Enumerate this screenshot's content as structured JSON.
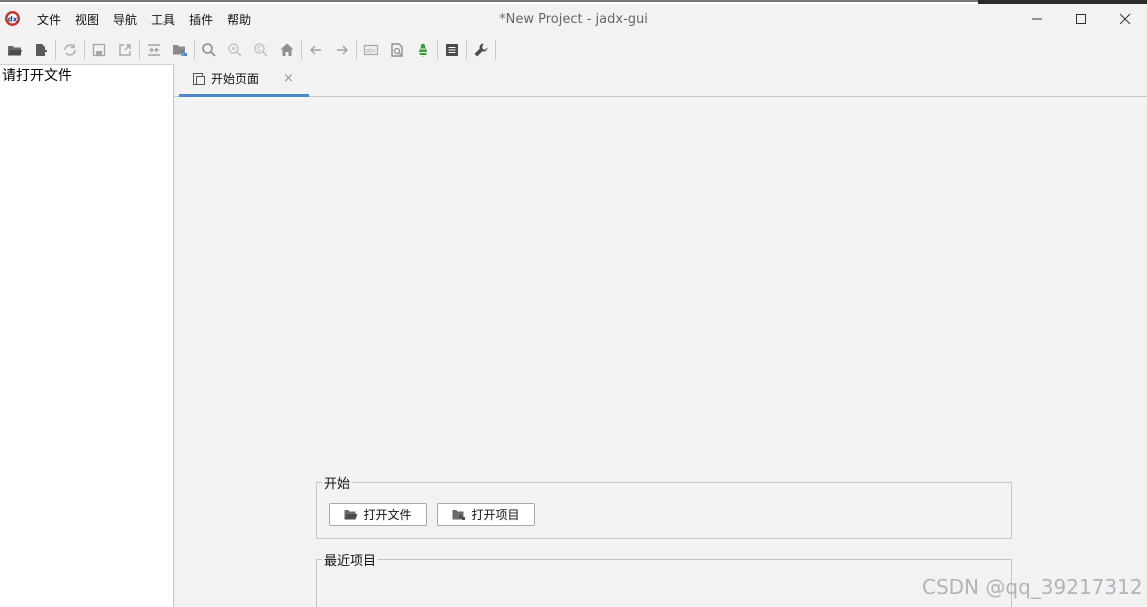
{
  "window": {
    "title": "*New Project - jadx-gui"
  },
  "menu": [
    {
      "label": "文件"
    },
    {
      "label": "视图"
    },
    {
      "label": "导航"
    },
    {
      "label": "工具"
    },
    {
      "label": "插件"
    },
    {
      "label": "帮助"
    }
  ],
  "toolbar": {
    "icons": [
      "open-folder-icon",
      "add-files-icon",
      "sync-icon",
      "save-icon",
      "export-icon",
      "flatten-packages-icon",
      "package-view-icon",
      "search-icon",
      "find-usage-icon",
      "find-class-icon",
      "home-icon",
      "back-arrow-icon",
      "forward-arrow-icon",
      "deobfuscation-icon",
      "quark-icon",
      "debug-bug-icon",
      "log-viewer-icon",
      "preferences-wrench-icon"
    ]
  },
  "tree": {
    "placeholder": "请打开文件"
  },
  "tabs": [
    {
      "label": "开始页面",
      "close": "×",
      "active": true
    }
  ],
  "start_page": {
    "start_group": {
      "title": "开始",
      "open_file": "打开文件",
      "open_project": "打开项目"
    },
    "recent_group": {
      "title": "最近项目"
    }
  },
  "watermark": "CSDN @qq_39217312",
  "colors": {
    "accent": "#4a88c7",
    "bug_green": "#3c9a3c",
    "background": "#f2f2f2"
  }
}
